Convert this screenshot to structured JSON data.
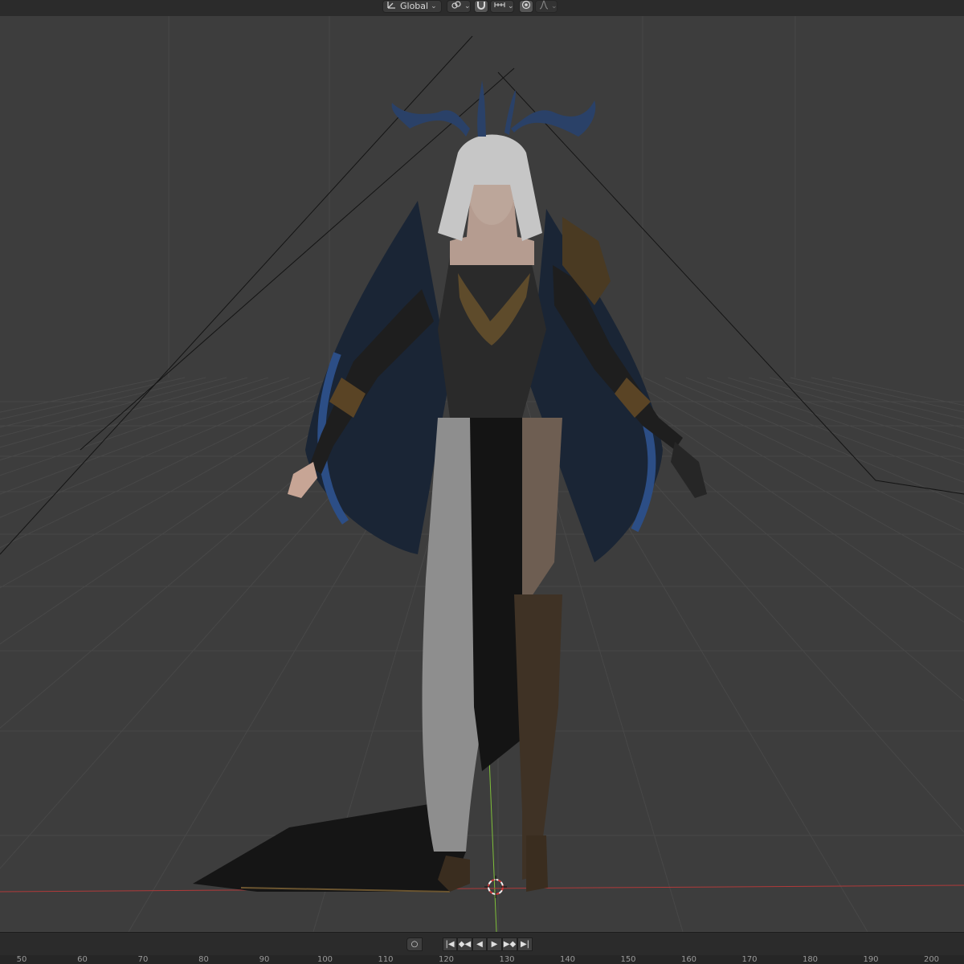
{
  "header": {
    "transform_orientation": "Global",
    "icons": [
      "transform-orientation-icon",
      "pivot-link-icon",
      "snap-magnet-icon",
      "snap-increment-icon",
      "proportional-edit-icon",
      "falloff-curve-icon"
    ]
  },
  "viewport": {
    "background": "#3d3d3d",
    "grid_color": "#4a4a4a",
    "x_axis_color": "#b03a3a",
    "z_axis_color": "#7fbf3a",
    "scene": "character-model"
  },
  "playback": {
    "buttons": [
      {
        "name": "keying-button",
        "glyph": "○"
      },
      {
        "name": "jump-to-start-button",
        "glyph": "|◀"
      },
      {
        "name": "prev-keyframe-button",
        "glyph": "◆◀"
      },
      {
        "name": "play-reverse-button",
        "glyph": "◀"
      },
      {
        "name": "play-button",
        "glyph": "▶"
      },
      {
        "name": "next-keyframe-button",
        "glyph": "▶◆"
      },
      {
        "name": "jump-to-end-button",
        "glyph": "▶|"
      }
    ]
  },
  "timeline": {
    "ticks": [
      "50",
      "60",
      "70",
      "80",
      "90",
      "100",
      "110",
      "120",
      "130",
      "140",
      "150",
      "160",
      "170",
      "180",
      "190",
      "200"
    ]
  }
}
